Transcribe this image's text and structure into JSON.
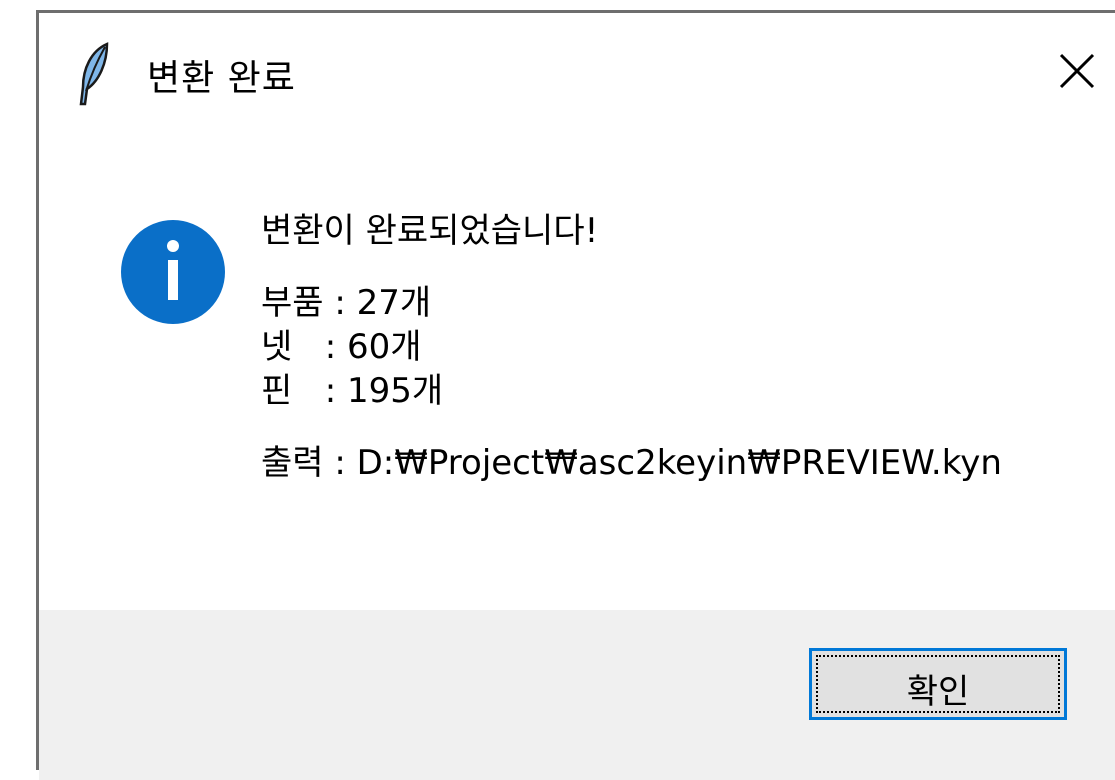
{
  "window": {
    "title": "변환 완료",
    "app_icon": "feather-icon",
    "close_icon": "close-icon"
  },
  "message": {
    "icon": "info-icon",
    "icon_color": "#0a6fc8",
    "headline": "변환이 완료되었습니다!",
    "stats": [
      "부품 : 27개",
      "넷   : 60개",
      "핀   : 195개"
    ],
    "output_line": "출력 : D:₩Project₩asc2keyin₩PREVIEW.kyn"
  },
  "buttons": {
    "ok_label": "확인",
    "accent": "#0078d7"
  }
}
